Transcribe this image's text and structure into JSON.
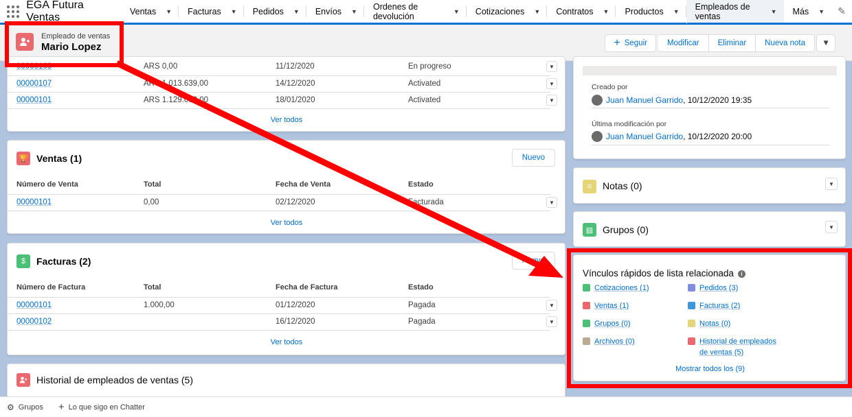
{
  "nav": {
    "app_name": "EGA Futura Ventas",
    "items": [
      {
        "label": "Ventas"
      },
      {
        "label": "Facturas"
      },
      {
        "label": "Pedidos"
      },
      {
        "label": "Envíos"
      },
      {
        "label": "Ordenes de devolución"
      },
      {
        "label": "Cotizaciones"
      },
      {
        "label": "Contratos"
      },
      {
        "label": "Productos"
      },
      {
        "label": "Empleados de ventas"
      },
      {
        "label": "Más"
      }
    ]
  },
  "record": {
    "type": "Empleado de ventas",
    "name": "Mario Lopez",
    "buttons": {
      "follow": "Seguir",
      "edit": "Modificar",
      "delete": "Eliminar",
      "new_note": "Nueva nota"
    }
  },
  "top_table": {
    "rows": [
      {
        "id": "00000108",
        "total": "ARS 0,00",
        "date": "11/12/2020",
        "status": "En progreso"
      },
      {
        "id": "00000107",
        "total": "ARS 1.013.639,00",
        "date": "14/12/2020",
        "status": "Activated"
      },
      {
        "id": "00000101",
        "total": "ARS 1.129.000,00",
        "date": "18/01/2020",
        "status": "Activated"
      }
    ],
    "view_all": "Ver todos"
  },
  "ventas": {
    "title": "Ventas (1)",
    "new": "Nuevo",
    "headers": [
      "Número de Venta",
      "Total",
      "Fecha de Venta",
      "Estado"
    ],
    "rows": [
      {
        "id": "00000101",
        "total": "0,00",
        "date": "02/12/2020",
        "status": "Facturada"
      }
    ],
    "view_all": "Ver todos"
  },
  "facturas": {
    "title": "Facturas (2)",
    "new": "Nuevo",
    "headers": [
      "Número de Factura",
      "Total",
      "Fecha de Factura",
      "Estado"
    ],
    "rows": [
      {
        "id": "00000101",
        "total": "1.000,00",
        "date": "01/12/2020",
        "status": "Pagada"
      },
      {
        "id": "00000102",
        "total": "",
        "date": "16/12/2020",
        "status": "Pagada"
      }
    ],
    "view_all": "Ver todos"
  },
  "historial": {
    "title": "Historial de empleados de ventas (5)"
  },
  "details": {
    "created_label": "Creado por",
    "created_user": "Juan Manuel Garrido",
    "created_date": ", 10/12/2020 19:35",
    "modified_label": "Última modificación por",
    "modified_user": "Juan Manuel Garrido",
    "modified_date": ", 10/12/2020 20:00"
  },
  "notas": {
    "title": "Notas (0)"
  },
  "grupos": {
    "title": "Grupos (0)"
  },
  "quick_links": {
    "title": "Vínculos rápidos de lista relacionada",
    "items": [
      {
        "label": "Cotizaciones (1)",
        "color": "#4bc076"
      },
      {
        "label": "Pedidos (3)",
        "color": "#7f8de1"
      },
      {
        "label": "Ventas (1)",
        "color": "#e9696e"
      },
      {
        "label": "Facturas (2)",
        "color": "#3c97dd"
      },
      {
        "label": "Grupos (0)",
        "color": "#4bc076"
      },
      {
        "label": "Notas (0)",
        "color": "#e6d478"
      },
      {
        "label": "Archivos (0)",
        "color": "#baac93"
      },
      {
        "label": "Historial de empleados",
        "label2": "de ventas (5)",
        "color": "#e9696e"
      }
    ],
    "show_all": "Mostrar todos los (9)"
  },
  "footer": {
    "groups": "Grupos",
    "chatter": "Lo que sigo en Chatter"
  },
  "colors": {
    "accent": "#0070d2",
    "annotation": "#ff0000"
  }
}
